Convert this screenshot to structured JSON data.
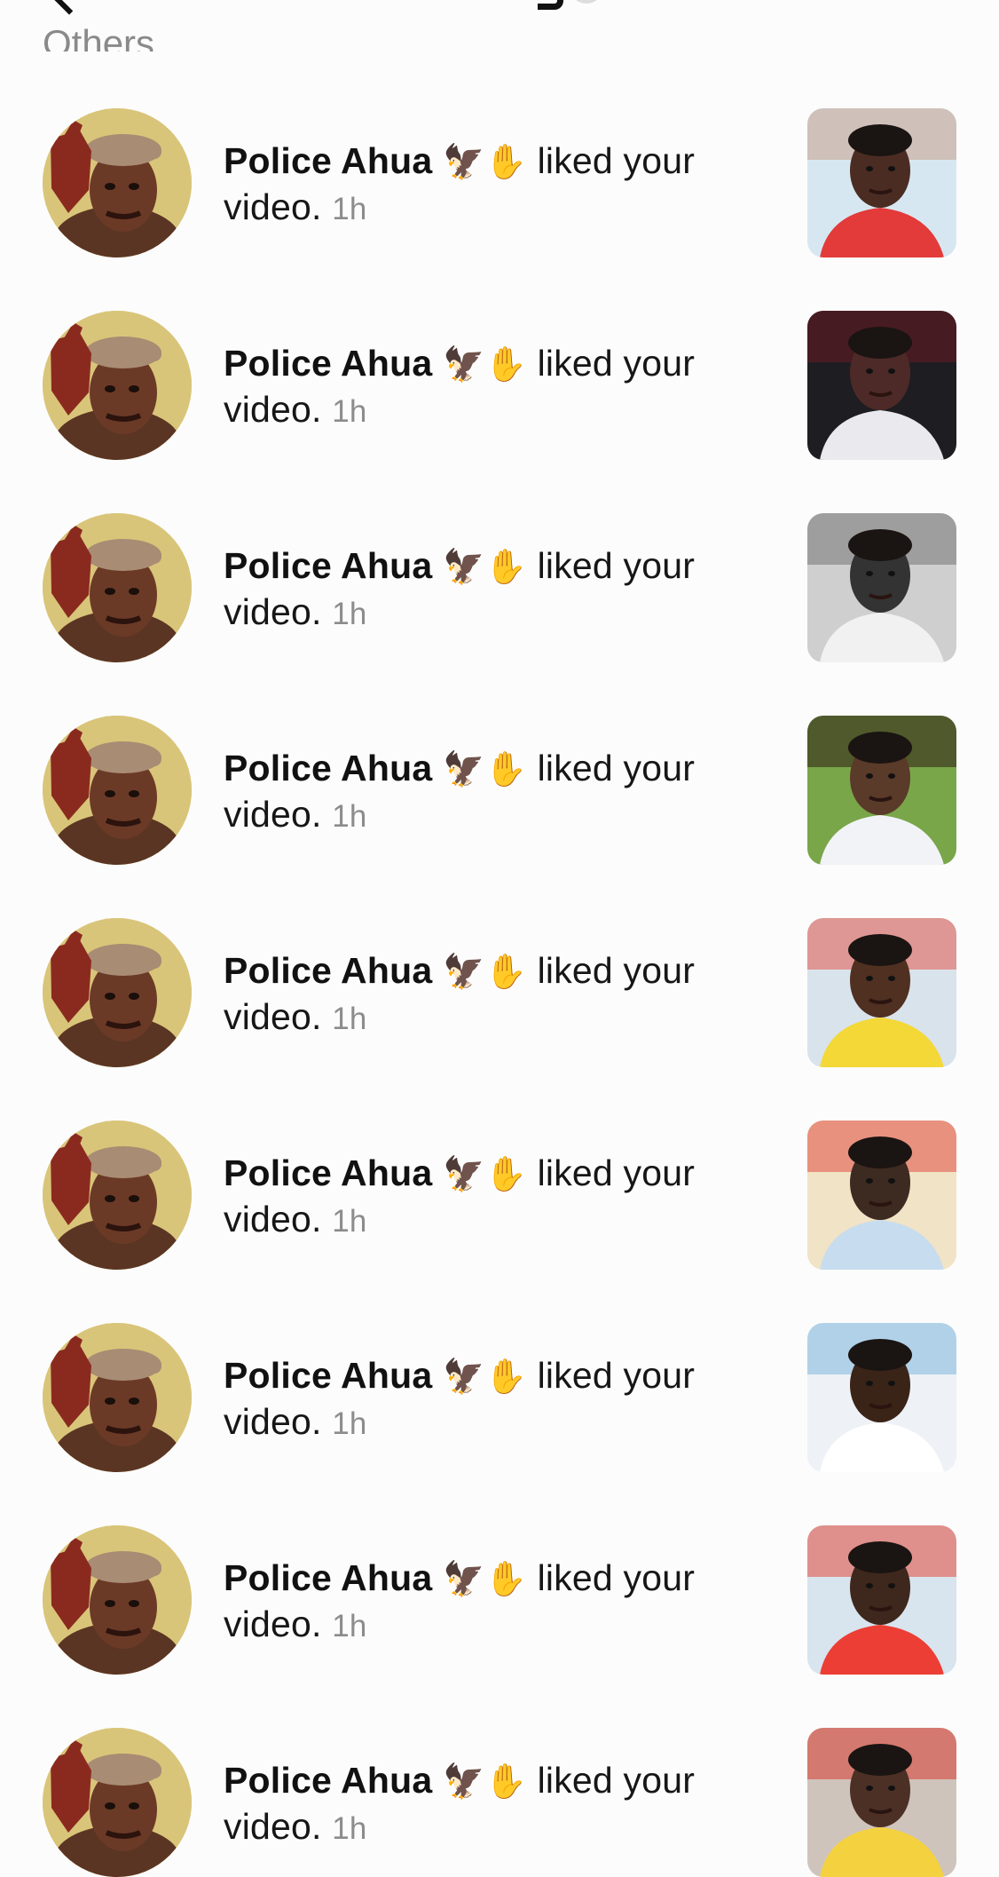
{
  "section": {
    "label": "Others"
  },
  "notifications": [
    {
      "username": "Police Ahua",
      "badge": "🦅✋",
      "action": "liked your video.",
      "time": "1h",
      "thumb_colors": [
        "#d7e7f1",
        "#c8a08c",
        "#e33a3a",
        "#4b2c22"
      ]
    },
    {
      "username": "Police Ahua",
      "badge": "🦅✋",
      "action": "liked your video.",
      "time": "1h",
      "thumb_colors": [
        "#1d1d22",
        "#6a1a22",
        "#e9e9ee",
        "#4d2a28"
      ]
    },
    {
      "username": "Police Ahua",
      "badge": "🦅✋",
      "action": "liked your video.",
      "time": "1h",
      "thumb_colors": [
        "#cfcfcf",
        "#777777",
        "#f1f1f1",
        "#333333"
      ]
    },
    {
      "username": "Police Ahua",
      "badge": "🦅✋",
      "action": "liked your video.",
      "time": "1h",
      "thumb_colors": [
        "#7aa64a",
        "#2b1a12",
        "#f2f3f7",
        "#5a3a29"
      ]
    },
    {
      "username": "Police Ahua",
      "badge": "🦅✋",
      "action": "liked your video.",
      "time": "1h",
      "thumb_colors": [
        "#d9e3ec",
        "#e2594c",
        "#f3d837",
        "#4f3021"
      ]
    },
    {
      "username": "Police Ahua",
      "badge": "🦅✋",
      "action": "liked your video.",
      "time": "1h",
      "thumb_colors": [
        "#f1e3c5",
        "#e04f44",
        "#c7dcef",
        "#3d2a21"
      ]
    },
    {
      "username": "Police Ahua",
      "badge": "🦅✋",
      "action": "liked your video.",
      "time": "1h",
      "thumb_colors": [
        "#eef2f6",
        "#7fb6df",
        "#ffffff",
        "#3a2418"
      ]
    },
    {
      "username": "Police Ahua",
      "badge": "🦅✋",
      "action": "liked your video.",
      "time": "1h",
      "thumb_colors": [
        "#d8e4ee",
        "#e64b3c",
        "#ec3e35",
        "#3e271c"
      ]
    },
    {
      "username": "Police Ahua",
      "badge": "🦅✋",
      "action": "liked your video.",
      "time": "1h",
      "thumb_colors": [
        "#cfc4bc",
        "#d93c30",
        "#f4d13e",
        "#4c3026"
      ]
    }
  ],
  "avatar_colors": {
    "background": "#d9c579",
    "skin": "#6b3a27",
    "cap": "#a98c74",
    "hand": "#8a2a1f"
  }
}
